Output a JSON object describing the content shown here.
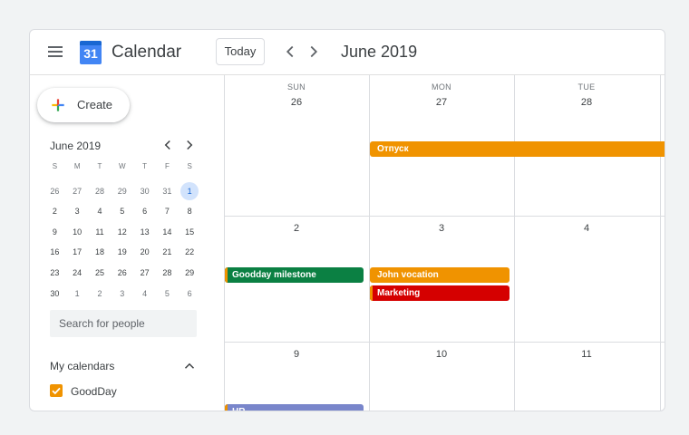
{
  "header": {
    "app_title": "Calendar",
    "logo_text": "31",
    "today_label": "Today",
    "month_title": "June 2019",
    "icons": {
      "menu": "menu-icon",
      "prev": "chevron-left-icon",
      "next": "chevron-right-icon"
    }
  },
  "sidebar": {
    "create_label": "Create",
    "mini_calendar": {
      "title": "June 2019",
      "weekdays": [
        "S",
        "M",
        "T",
        "W",
        "T",
        "F",
        "S"
      ],
      "weeks": [
        [
          "26",
          "27",
          "28",
          "29",
          "30",
          "31",
          "1"
        ],
        [
          "2",
          "3",
          "4",
          "5",
          "6",
          "7",
          "8"
        ],
        [
          "9",
          "10",
          "11",
          "12",
          "13",
          "14",
          "15"
        ],
        [
          "16",
          "17",
          "18",
          "19",
          "20",
          "21",
          "22"
        ],
        [
          "23",
          "24",
          "25",
          "26",
          "27",
          "28",
          "29"
        ],
        [
          "30",
          "1",
          "2",
          "3",
          "4",
          "5",
          "6"
        ]
      ],
      "selected": "1"
    },
    "search_placeholder": "Search for people",
    "my_calendars_title": "My calendars",
    "calendars": [
      {
        "name": "GoodDay",
        "color": "#f09300",
        "checked": true
      }
    ]
  },
  "grid": {
    "columns": [
      {
        "dow": "SUN",
        "day": "26"
      },
      {
        "dow": "MON",
        "day": "27"
      },
      {
        "dow": "TUE",
        "day": "28"
      }
    ],
    "rows": [
      [
        "2",
        "3",
        "4"
      ],
      [
        "9",
        "10",
        "11"
      ]
    ],
    "events": [
      {
        "title": "Отпуск",
        "color": "#f09300"
      },
      {
        "title": "Goodday milestone",
        "color": "#0b8043"
      },
      {
        "title": "John vocation",
        "color": "#f09300"
      },
      {
        "title": "Marketing",
        "color": "#d50000"
      },
      {
        "title": "HR",
        "color": "#7986cb"
      }
    ]
  }
}
